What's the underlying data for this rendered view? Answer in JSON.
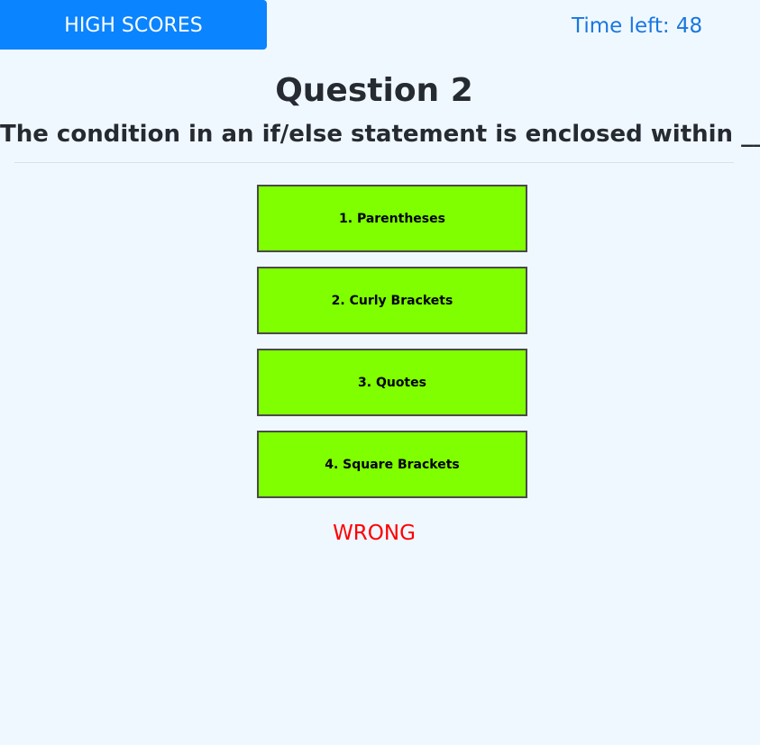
{
  "header": {
    "highscores_label": "HIGH SCORES",
    "timer_text": "Time left: 48"
  },
  "quiz": {
    "question_title": "Question 2",
    "question_text": "The condition in an if/else statement is enclosed within ____",
    "answers": [
      {
        "label": "1. Parentheses"
      },
      {
        "label": "2. Curly Brackets"
      },
      {
        "label": "3. Quotes"
      },
      {
        "label": "4. Square Brackets"
      }
    ],
    "feedback": "WRONG"
  },
  "colors": {
    "background": "#f0f8ff",
    "highscores_button": "#0a84ff",
    "timer_text": "#1877e0",
    "answer_button": "#7fff00",
    "feedback_wrong": "#ff0000"
  }
}
